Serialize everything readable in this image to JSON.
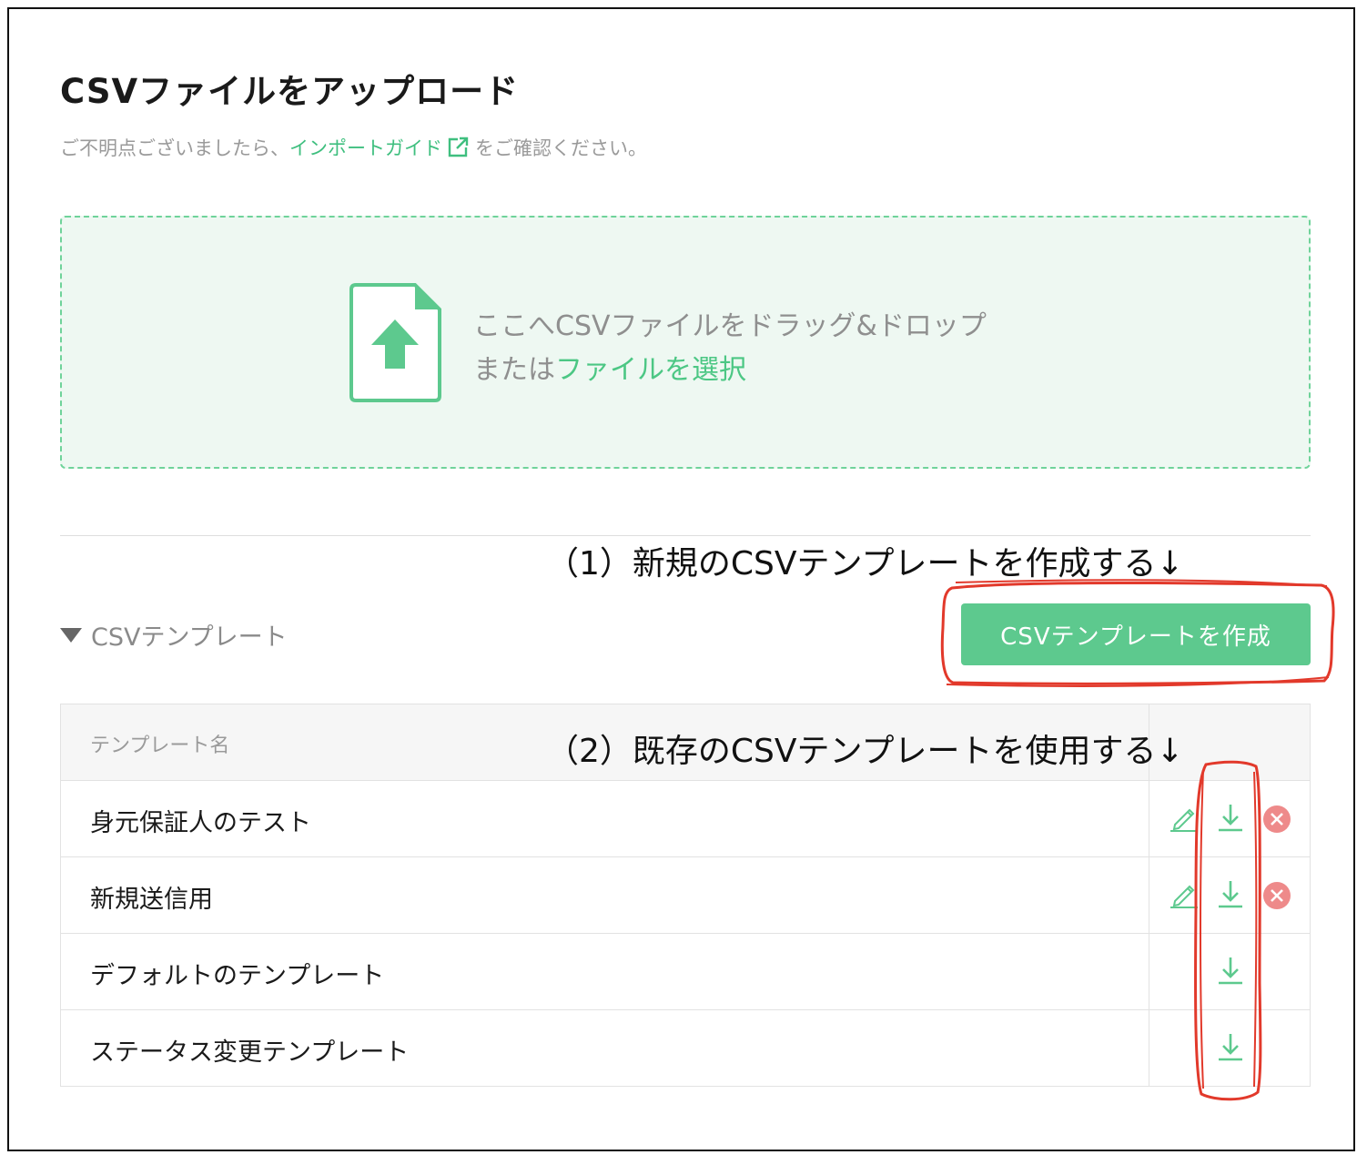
{
  "page": {
    "title": "CSVファイルをアップロード",
    "subtitle_before": "ご不明点ございましたら、",
    "subtitle_link": "インポートガイド",
    "subtitle_after": "をご確認ください。"
  },
  "dropzone": {
    "line1": "ここへCSVファイルをドラッグ&ドロップ",
    "line2_prefix": "または",
    "line2_link": "ファイルを選択"
  },
  "annotations": {
    "create_note": "（1）新規のCSVテンプレートを作成する↓",
    "use_note": "（2）既存のCSVテンプレートを使用する↓"
  },
  "templates": {
    "section_label": "CSVテンプレート",
    "create_button": "CSVテンプレートを作成",
    "column_name": "テンプレート名",
    "rows": [
      {
        "name": "身元保証人のテスト",
        "editable": true,
        "deletable": true
      },
      {
        "name": "新規送信用",
        "editable": true,
        "deletable": true
      },
      {
        "name": "デフォルトのテンプレート",
        "editable": false,
        "deletable": false
      },
      {
        "name": "ステータス変更テンプレート",
        "editable": false,
        "deletable": false
      }
    ]
  },
  "icons": {
    "external_link": "external-link-icon",
    "file_upload": "file-upload-icon",
    "edit": "pencil-icon",
    "download": "download-icon",
    "delete": "delete-icon",
    "collapse": "caret-down-icon"
  },
  "colors": {
    "accent": "#4cc784",
    "button": "#5dc98e",
    "dropzone_bg": "#eef8f2",
    "delete": "#ee8a8a",
    "annotation_red": "#e2392b"
  }
}
